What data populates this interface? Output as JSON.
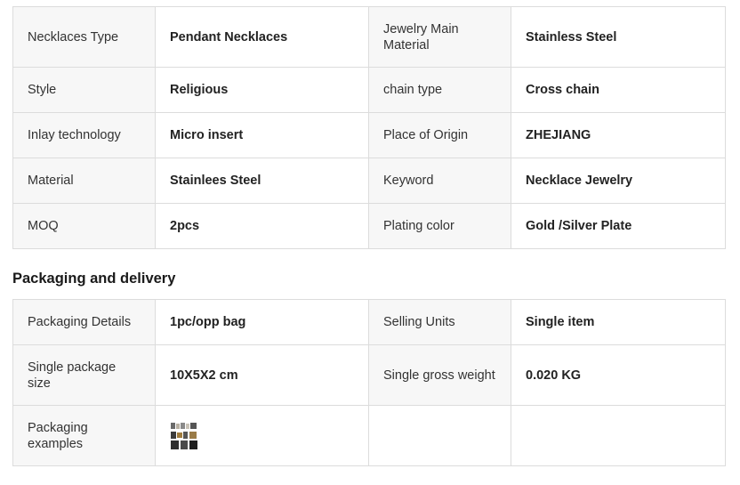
{
  "specs": {
    "rows": [
      {
        "k1": "Necklaces Type",
        "v1": "Pendant Necklaces",
        "k2": "Jewelry Main Material",
        "v2": "Stainless Steel"
      },
      {
        "k1": "Style",
        "v1": "Religious",
        "k2": "chain type",
        "v2": "Cross chain"
      },
      {
        "k1": "Inlay technology",
        "v1": "Micro insert",
        "k2": "Place of Origin",
        "v2": "ZHEJIANG"
      },
      {
        "k1": "Material",
        "v1": "Stainlees Steel",
        "k2": "Keyword",
        "v2": "Necklace Jewelry"
      },
      {
        "k1": "MOQ",
        "v1": "2pcs",
        "k2": "Plating color",
        "v2": "Gold /Silver Plate"
      }
    ]
  },
  "packaging": {
    "title": "Packaging and delivery",
    "rows": [
      {
        "k1": "Packaging Details",
        "v1": "1pc/opp bag",
        "k2": "Selling Units",
        "v2": "Single item"
      },
      {
        "k1": "Single package size",
        "v1": "10X5X2 cm",
        "k2": "Single gross weight",
        "v2": "0.020 KG"
      }
    ],
    "examples_label": "Packaging examples"
  }
}
